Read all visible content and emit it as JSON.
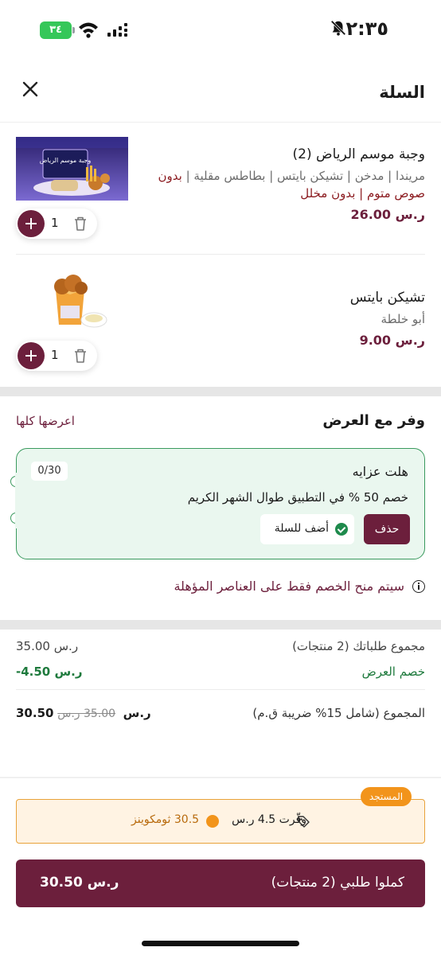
{
  "status_bar": {
    "time": "٢:٣٥",
    "battery": "٣٤",
    "icons": [
      "bell-slash-icon",
      "wifi-icon",
      "signal-icon"
    ]
  },
  "header": {
    "title": "السلة",
    "close_icon": "close-icon"
  },
  "items": [
    {
      "name": "وجبة موسم الرياض (2)",
      "desc_plain": "مريندا | مدخن | تشيكن بايتس | بطاطس مقلية | ",
      "desc_red": "بدون صوص متوم | بدون مخلل",
      "price": "26.00",
      "quantity": "1",
      "image_text": "وجبة موسم الرياض"
    },
    {
      "name": "تشيكن بايتس",
      "desc_plain": "أبو خلطة",
      "desc_red": "",
      "price": "9.00",
      "quantity": "1"
    }
  ],
  "offers": {
    "title": "وفر مع العرض",
    "see_all": "اعرضها كلها",
    "card": {
      "name": "هلت عزايه",
      "count": "0/30",
      "description": "خصم 50 % في التطبيق طوال الشهر الكريم",
      "added_label": "أضف للسلة",
      "delete_label": "حذف"
    },
    "notice": "سيتم منح الخصم فقط على العناصر المؤهلة"
  },
  "summary": {
    "subtotal_label": "مجموع طلباتك (2 منتجات)",
    "subtotal_value": "35.00",
    "discount_label": "خصم العرض",
    "discount_value": "-4.50",
    "total_label": "المجموع (شامل 15% ضريبة ق.م)",
    "total_old": "35.00",
    "total_value": "30.50",
    "currency": "ر.س"
  },
  "savings": {
    "badge": "المستجد",
    "saved_label": "وفّرت",
    "saved_value": "4.5",
    "coins_label": "30.5 ثومكوينز"
  },
  "checkout": {
    "label": "كملوا طلبي (2 منتجات)",
    "total": "30.50"
  },
  "colors": {
    "brand": "#6c1f3c",
    "green": "#1e7a3d",
    "orange": "#f2941b"
  }
}
